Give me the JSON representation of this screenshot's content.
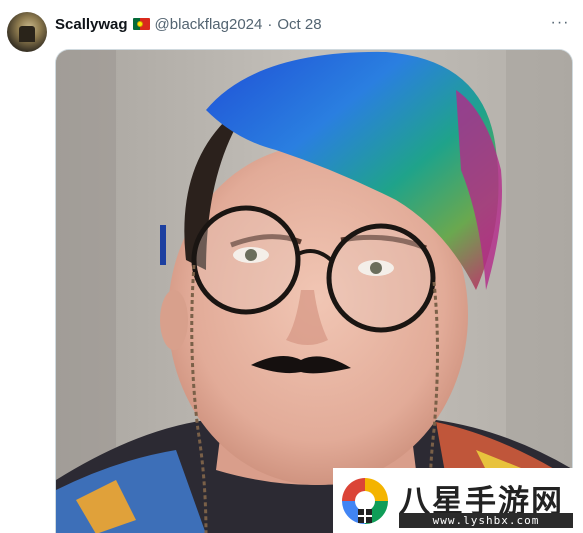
{
  "post": {
    "display_name": "Scallywag",
    "flag_icon": "portugal-flag-icon",
    "handle": "@blackflag2024",
    "separator": "·",
    "date": "Oct 28",
    "more_label": "···"
  },
  "media": {
    "type": "photo"
  },
  "watermark": {
    "title": "八星手游网",
    "url": "www.lyshbx.com"
  },
  "colors": {
    "text_primary": "#0f1419",
    "text_secondary": "#536471",
    "border": "#cfd9de"
  }
}
